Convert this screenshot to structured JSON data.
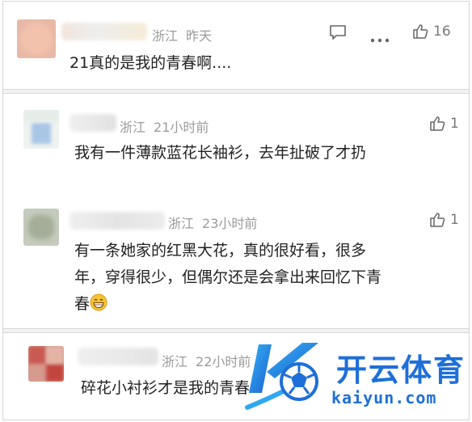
{
  "comments": [
    {
      "location": "浙江",
      "time": "昨天",
      "likes": "16",
      "text": "21真的是我的青春啊...."
    },
    {
      "location": "浙江",
      "time": "21小时前",
      "likes": "1",
      "text": "我有一件薄款蓝花长袖衫，去年扯破了才扔"
    },
    {
      "location": "浙江",
      "time": "23小时前",
      "likes": "1",
      "text_lines": [
        "有一条她家的红黑大花，真的很好看，很多",
        "年，穿得很少，但偶尔还是会拿出来回忆下青",
        "春"
      ]
    },
    {
      "location": "浙江",
      "time": "22小时前",
      "text": "碎花小衬衫才是我的青春"
    }
  ],
  "watermark": {
    "brand": "开云体育",
    "domain": "kaiyun.com",
    "colors": {
      "blue": "#1e6fd9",
      "light_blue": "#2fa8f0"
    }
  }
}
